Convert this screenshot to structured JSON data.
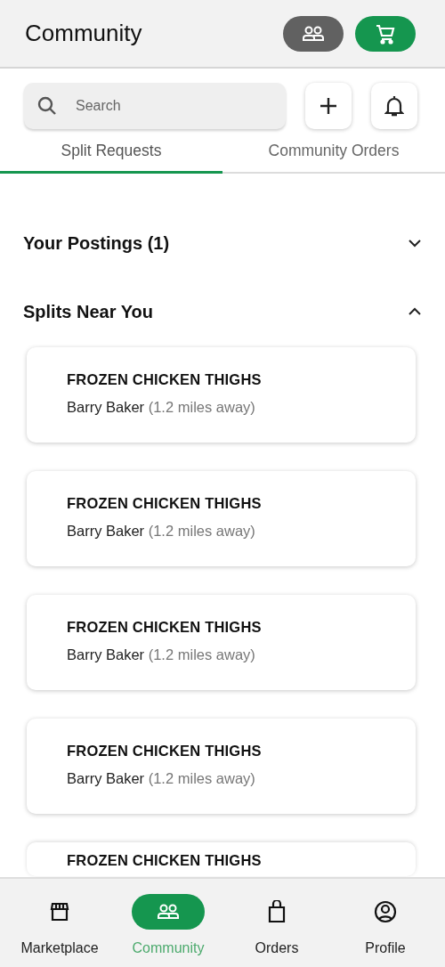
{
  "header": {
    "title": "Community"
  },
  "search": {
    "placeholder": "Search"
  },
  "tabs": [
    {
      "label": "Split Requests",
      "selected": true
    },
    {
      "label": "Community Orders",
      "selected": false
    }
  ],
  "sections": [
    {
      "title": "Your Postings (1)",
      "expanded": false
    },
    {
      "title": "Splits Near You",
      "expanded": true,
      "cards": [
        {
          "title": "FROZEN CHICKEN THIGHS",
          "seller": "Barry Baker",
          "distance": "(1.2 miles away)"
        },
        {
          "title": "FROZEN CHICKEN THIGHS",
          "seller": "Barry Baker",
          "distance": "(1.2 miles away)"
        },
        {
          "title": "FROZEN CHICKEN THIGHS",
          "seller": "Barry Baker",
          "distance": "(1.2 miles away)"
        },
        {
          "title": "FROZEN CHICKEN THIGHS",
          "seller": "Barry Baker",
          "distance": "(1.2 miles away)"
        },
        {
          "title": "FROZEN CHICKEN THIGHS"
        }
      ]
    }
  ],
  "nav": [
    {
      "kind": "store",
      "label": "Marketplace",
      "selected": false
    },
    {
      "kind": "people",
      "label": "Community",
      "selected": true
    },
    {
      "kind": "bag",
      "label": "Orders",
      "selected": false
    },
    {
      "kind": "profile",
      "label": "Profile",
      "selected": false
    }
  ]
}
